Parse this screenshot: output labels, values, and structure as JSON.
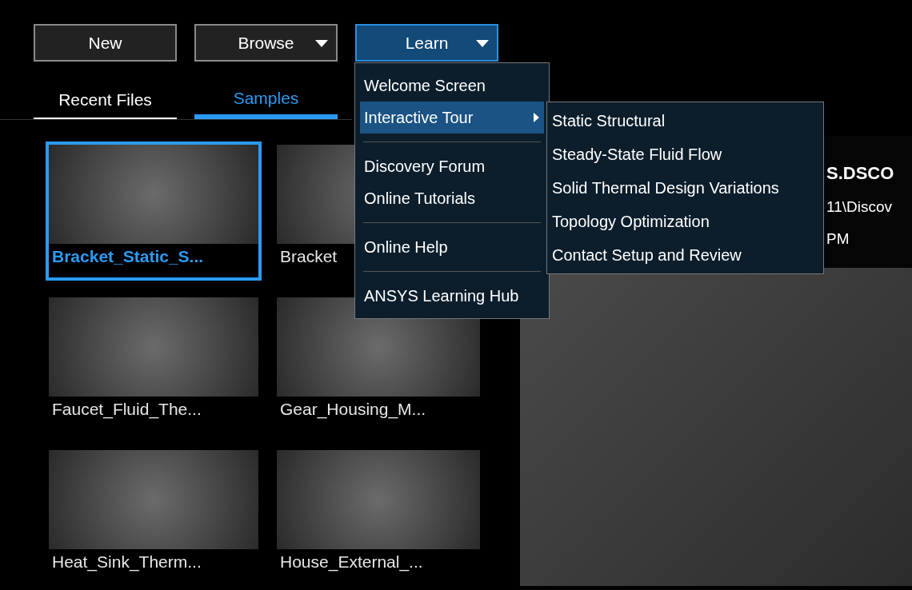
{
  "toolbar": {
    "buttons": [
      {
        "label": "New",
        "kind": "plain",
        "selected": false
      },
      {
        "label": "Browse",
        "kind": "dropdown",
        "selected": false
      },
      {
        "label": "Learn",
        "kind": "dropdown",
        "selected": true
      }
    ]
  },
  "tabs": [
    {
      "label": "Recent Files",
      "selected": false
    },
    {
      "label": "Samples",
      "selected": true
    }
  ],
  "samples": [
    {
      "label": "Bracket_Static_S...",
      "selected": true
    },
    {
      "label": "Bracket",
      "selected": false
    },
    {
      "label": "Faucet_Fluid_The...",
      "selected": false
    },
    {
      "label": "Gear_Housing_M...",
      "selected": false
    },
    {
      "label": "Heat_Sink_Therm...",
      "selected": false
    },
    {
      "label": "House_External_...",
      "selected": false
    }
  ],
  "detail": {
    "title": "S.DSCO",
    "path": "11\\Discov",
    "saved": "PM"
  },
  "learn_menu": {
    "items": [
      {
        "kind": "item",
        "label": "Welcome Screen",
        "selected": false,
        "submenu": false
      },
      {
        "kind": "item",
        "label": "Interactive Tour",
        "selected": true,
        "submenu": true
      },
      {
        "kind": "separator"
      },
      {
        "kind": "item",
        "label": "Discovery Forum",
        "selected": false,
        "submenu": false
      },
      {
        "kind": "item",
        "label": "Online Tutorials",
        "selected": false,
        "submenu": false
      },
      {
        "kind": "separator"
      },
      {
        "kind": "item",
        "label": "Online Help",
        "selected": false,
        "submenu": false
      },
      {
        "kind": "separator"
      },
      {
        "kind": "item",
        "label": "ANSYS Learning Hub",
        "selected": false,
        "submenu": false
      }
    ]
  },
  "tour_submenu": {
    "items": [
      "Static Structural",
      "Steady-State Fluid Flow",
      "Solid Thermal Design Variations",
      "Topology Optimization",
      "Contact Setup and Review"
    ]
  }
}
